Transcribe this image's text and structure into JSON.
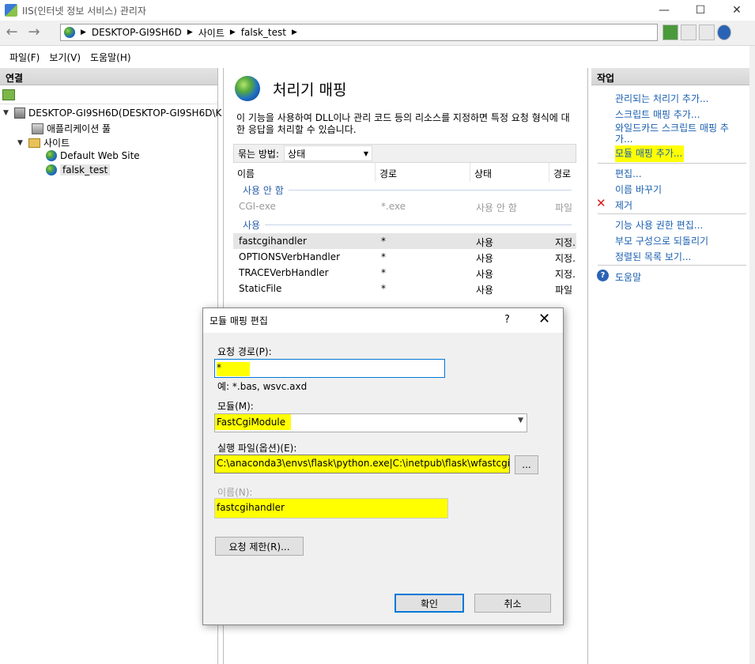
{
  "window": {
    "title": "IIS(인터넷 정보 서비스) 관리자",
    "minimize_glyph": "—",
    "maximize_glyph": "☐",
    "close_glyph": "✕"
  },
  "address": {
    "back_glyph": "←",
    "forward_glyph": "→",
    "segments": [
      "DESKTOP-GI9SH6D",
      "사이트",
      "falsk_test"
    ],
    "separator_glyph": "▶"
  },
  "menu": [
    "파일(F)",
    "보기(V)",
    "도움말(H)"
  ],
  "connections": {
    "header": "연결",
    "tree": {
      "server": "DESKTOP-GI9SH6D(DESKTOP-GI9SH6D\\K",
      "app_pools": "애플리케이션 풀",
      "sites": "사이트",
      "default_site": "Default Web Site",
      "selected_site": "falsk_test"
    }
  },
  "feature": {
    "title": "처리기 매핑",
    "description": "이 기능을 사용하여 DLL이나 관리 코드 등의 리소스를 지정하면 특정 요청 형식에 대한 응답을 처리할 수 있습니다.",
    "group_by_label": "묶는 방법:",
    "group_by_value": "상태",
    "columns": [
      "이름",
      "경로",
      "상태",
      "경로"
    ],
    "groups": [
      {
        "label": "사용 안 함",
        "rows": [
          {
            "name": "CGI-exe",
            "path": "*.exe",
            "state": "사용 안 함",
            "type": "파일"
          }
        ]
      },
      {
        "label": "사용",
        "rows": [
          {
            "name": "fastcgihandler",
            "path": "*",
            "state": "사용",
            "type": "지정."
          },
          {
            "name": "OPTIONSVerbHandler",
            "path": "*",
            "state": "사용",
            "type": "지정."
          },
          {
            "name": "TRACEVerbHandler",
            "path": "*",
            "state": "사용",
            "type": "지정."
          },
          {
            "name": "StaticFile",
            "path": "*",
            "state": "사용",
            "type": "파일"
          }
        ]
      }
    ]
  },
  "actions": {
    "header": "작업",
    "items": [
      "관리되는 처리기 추가...",
      "스크립트 매핑 추가...",
      "와일드카드 스크립트 매핑 추",
      "가...",
      "모듈 매핑 추가...",
      "편집...",
      "이름 바꾸기",
      "제거",
      "기능 사용 권한 편집...",
      "부모 구성으로 되돌리기",
      "정렬된 목록 보기...",
      "도움말"
    ]
  },
  "dialog": {
    "title": "모듈 매핑 편집",
    "help_glyph": "?",
    "close_glyph": "✕",
    "request_path_label": "요청 경로(P):",
    "request_path_value": "*",
    "example": "예: *.bas, wsvc.axd",
    "module_label": "모듈(M):",
    "module_value": "FastCgiModule",
    "executable_label": "실행 파일(옵션)(E):",
    "executable_value": "C:\\anaconda3\\envs\\flask\\python.exe|C:\\inetpub\\flask\\wfastcgi.",
    "browse_label": "...",
    "name_label": "이름(N):",
    "name_value": "fastcgihandler",
    "restrictions_button": "요청 제한(R)...",
    "ok_button": "확인",
    "cancel_button": "취소"
  },
  "colors": {
    "highlight": "#ffff00",
    "link": "#1a5fb0",
    "selection": "#e5e5e5",
    "focus": "#0078d7"
  }
}
